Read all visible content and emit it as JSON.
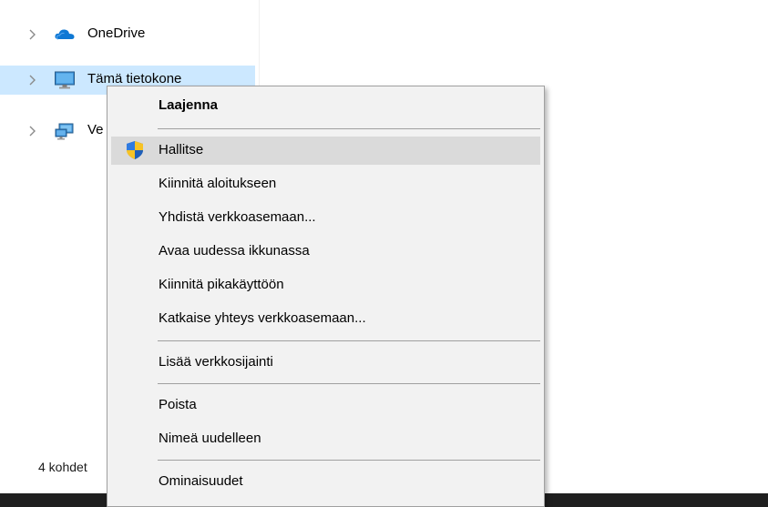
{
  "nav": {
    "items": [
      {
        "label": "OneDrive",
        "icon": "onedrive-cloud-icon",
        "selected": false
      },
      {
        "label": "Tämä tietokone",
        "icon": "this-pc-monitor-icon",
        "selected": true
      },
      {
        "label": "Ve",
        "icon": "network-icon",
        "selected": false
      }
    ]
  },
  "status": {
    "text": "4 kohdet"
  },
  "context_menu": {
    "items": [
      {
        "label": "Laajenna",
        "bold": true
      },
      {
        "label": "Hallitse",
        "icon": "uac-shield-icon",
        "highlighted": true
      },
      {
        "label": "Kiinnitä aloitukseen"
      },
      {
        "label": "Yhdistä verkkoasemaan..."
      },
      {
        "label": "Avaa uudessa ikkunassa"
      },
      {
        "label": "Kiinnitä pikakäyttöön"
      },
      {
        "label": "Katkaise yhteys verkkoasemaan..."
      },
      {
        "label": "Lisää verkkosijainti"
      },
      {
        "label": "Poista"
      },
      {
        "label": "Nimeä uudelleen"
      },
      {
        "label": "Ominaisuudet"
      }
    ]
  },
  "colors": {
    "selection": "#cce8ff",
    "menu_background": "#f2f2f2",
    "menu_hover": "#dadada",
    "onedrive_blue": "#0f78d4",
    "shield_blue": "#2a6dcf",
    "shield_yellow": "#f7c325"
  }
}
